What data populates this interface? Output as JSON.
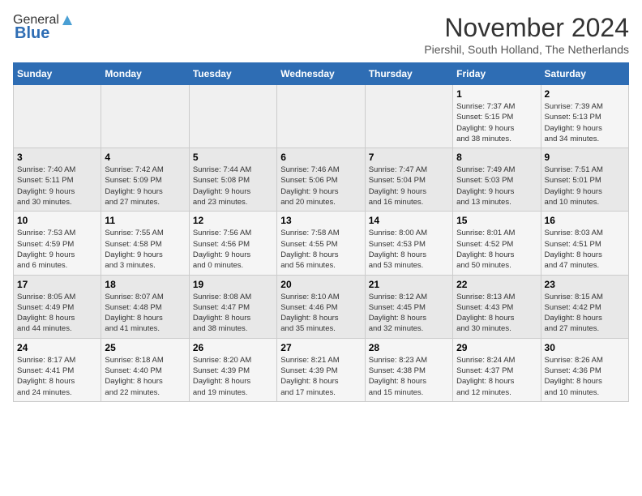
{
  "header": {
    "logo_general": "General",
    "logo_blue": "Blue",
    "month_title": "November 2024",
    "location": "Piershil, South Holland, The Netherlands"
  },
  "weekdays": [
    "Sunday",
    "Monday",
    "Tuesday",
    "Wednesday",
    "Thursday",
    "Friday",
    "Saturday"
  ],
  "weeks": [
    [
      {
        "day": "",
        "info": ""
      },
      {
        "day": "",
        "info": ""
      },
      {
        "day": "",
        "info": ""
      },
      {
        "day": "",
        "info": ""
      },
      {
        "day": "",
        "info": ""
      },
      {
        "day": "1",
        "info": "Sunrise: 7:37 AM\nSunset: 5:15 PM\nDaylight: 9 hours\nand 38 minutes."
      },
      {
        "day": "2",
        "info": "Sunrise: 7:39 AM\nSunset: 5:13 PM\nDaylight: 9 hours\nand 34 minutes."
      }
    ],
    [
      {
        "day": "3",
        "info": "Sunrise: 7:40 AM\nSunset: 5:11 PM\nDaylight: 9 hours\nand 30 minutes."
      },
      {
        "day": "4",
        "info": "Sunrise: 7:42 AM\nSunset: 5:09 PM\nDaylight: 9 hours\nand 27 minutes."
      },
      {
        "day": "5",
        "info": "Sunrise: 7:44 AM\nSunset: 5:08 PM\nDaylight: 9 hours\nand 23 minutes."
      },
      {
        "day": "6",
        "info": "Sunrise: 7:46 AM\nSunset: 5:06 PM\nDaylight: 9 hours\nand 20 minutes."
      },
      {
        "day": "7",
        "info": "Sunrise: 7:47 AM\nSunset: 5:04 PM\nDaylight: 9 hours\nand 16 minutes."
      },
      {
        "day": "8",
        "info": "Sunrise: 7:49 AM\nSunset: 5:03 PM\nDaylight: 9 hours\nand 13 minutes."
      },
      {
        "day": "9",
        "info": "Sunrise: 7:51 AM\nSunset: 5:01 PM\nDaylight: 9 hours\nand 10 minutes."
      }
    ],
    [
      {
        "day": "10",
        "info": "Sunrise: 7:53 AM\nSunset: 4:59 PM\nDaylight: 9 hours\nand 6 minutes."
      },
      {
        "day": "11",
        "info": "Sunrise: 7:55 AM\nSunset: 4:58 PM\nDaylight: 9 hours\nand 3 minutes."
      },
      {
        "day": "12",
        "info": "Sunrise: 7:56 AM\nSunset: 4:56 PM\nDaylight: 9 hours\nand 0 minutes."
      },
      {
        "day": "13",
        "info": "Sunrise: 7:58 AM\nSunset: 4:55 PM\nDaylight: 8 hours\nand 56 minutes."
      },
      {
        "day": "14",
        "info": "Sunrise: 8:00 AM\nSunset: 4:53 PM\nDaylight: 8 hours\nand 53 minutes."
      },
      {
        "day": "15",
        "info": "Sunrise: 8:01 AM\nSunset: 4:52 PM\nDaylight: 8 hours\nand 50 minutes."
      },
      {
        "day": "16",
        "info": "Sunrise: 8:03 AM\nSunset: 4:51 PM\nDaylight: 8 hours\nand 47 minutes."
      }
    ],
    [
      {
        "day": "17",
        "info": "Sunrise: 8:05 AM\nSunset: 4:49 PM\nDaylight: 8 hours\nand 44 minutes."
      },
      {
        "day": "18",
        "info": "Sunrise: 8:07 AM\nSunset: 4:48 PM\nDaylight: 8 hours\nand 41 minutes."
      },
      {
        "day": "19",
        "info": "Sunrise: 8:08 AM\nSunset: 4:47 PM\nDaylight: 8 hours\nand 38 minutes."
      },
      {
        "day": "20",
        "info": "Sunrise: 8:10 AM\nSunset: 4:46 PM\nDaylight: 8 hours\nand 35 minutes."
      },
      {
        "day": "21",
        "info": "Sunrise: 8:12 AM\nSunset: 4:45 PM\nDaylight: 8 hours\nand 32 minutes."
      },
      {
        "day": "22",
        "info": "Sunrise: 8:13 AM\nSunset: 4:43 PM\nDaylight: 8 hours\nand 30 minutes."
      },
      {
        "day": "23",
        "info": "Sunrise: 8:15 AM\nSunset: 4:42 PM\nDaylight: 8 hours\nand 27 minutes."
      }
    ],
    [
      {
        "day": "24",
        "info": "Sunrise: 8:17 AM\nSunset: 4:41 PM\nDaylight: 8 hours\nand 24 minutes."
      },
      {
        "day": "25",
        "info": "Sunrise: 8:18 AM\nSunset: 4:40 PM\nDaylight: 8 hours\nand 22 minutes."
      },
      {
        "day": "26",
        "info": "Sunrise: 8:20 AM\nSunset: 4:39 PM\nDaylight: 8 hours\nand 19 minutes."
      },
      {
        "day": "27",
        "info": "Sunrise: 8:21 AM\nSunset: 4:39 PM\nDaylight: 8 hours\nand 17 minutes."
      },
      {
        "day": "28",
        "info": "Sunrise: 8:23 AM\nSunset: 4:38 PM\nDaylight: 8 hours\nand 15 minutes."
      },
      {
        "day": "29",
        "info": "Sunrise: 8:24 AM\nSunset: 4:37 PM\nDaylight: 8 hours\nand 12 minutes."
      },
      {
        "day": "30",
        "info": "Sunrise: 8:26 AM\nSunset: 4:36 PM\nDaylight: 8 hours\nand 10 minutes."
      }
    ]
  ]
}
